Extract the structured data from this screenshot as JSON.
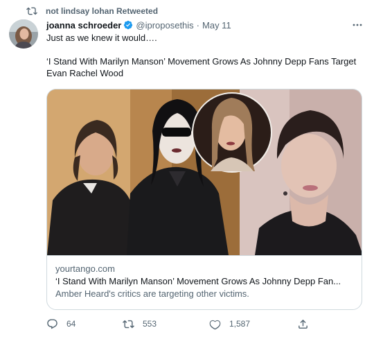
{
  "retweet_banner": {
    "text": "not lindsay lohan Retweeted",
    "icon": "retweet-icon"
  },
  "author": {
    "name": "joanna schroeder",
    "handle": "@iproposethis",
    "separator": "·",
    "date": "May 11",
    "verified": true,
    "avatar": "avatar-photo"
  },
  "tweet": {
    "line1": "Just as we knew it would….",
    "line2": "‘I Stand With Marilyn Manson’ Movement Grows As Johnny Depp Fans Target Evan Rachel Wood"
  },
  "card": {
    "domain": "yourtango.com",
    "title": "‘I Stand With Marilyn Manson’ Movement Grows As Johnny Depp Fan...",
    "description": "Amber Heard's critics are targeting other victims."
  },
  "actions": {
    "replies": "64",
    "retweets": "553",
    "likes": "1,587"
  },
  "colors": {
    "text": "#0f1419",
    "secondary": "#536471",
    "verified": "#1d9bf0",
    "border": "#cfd9de"
  }
}
